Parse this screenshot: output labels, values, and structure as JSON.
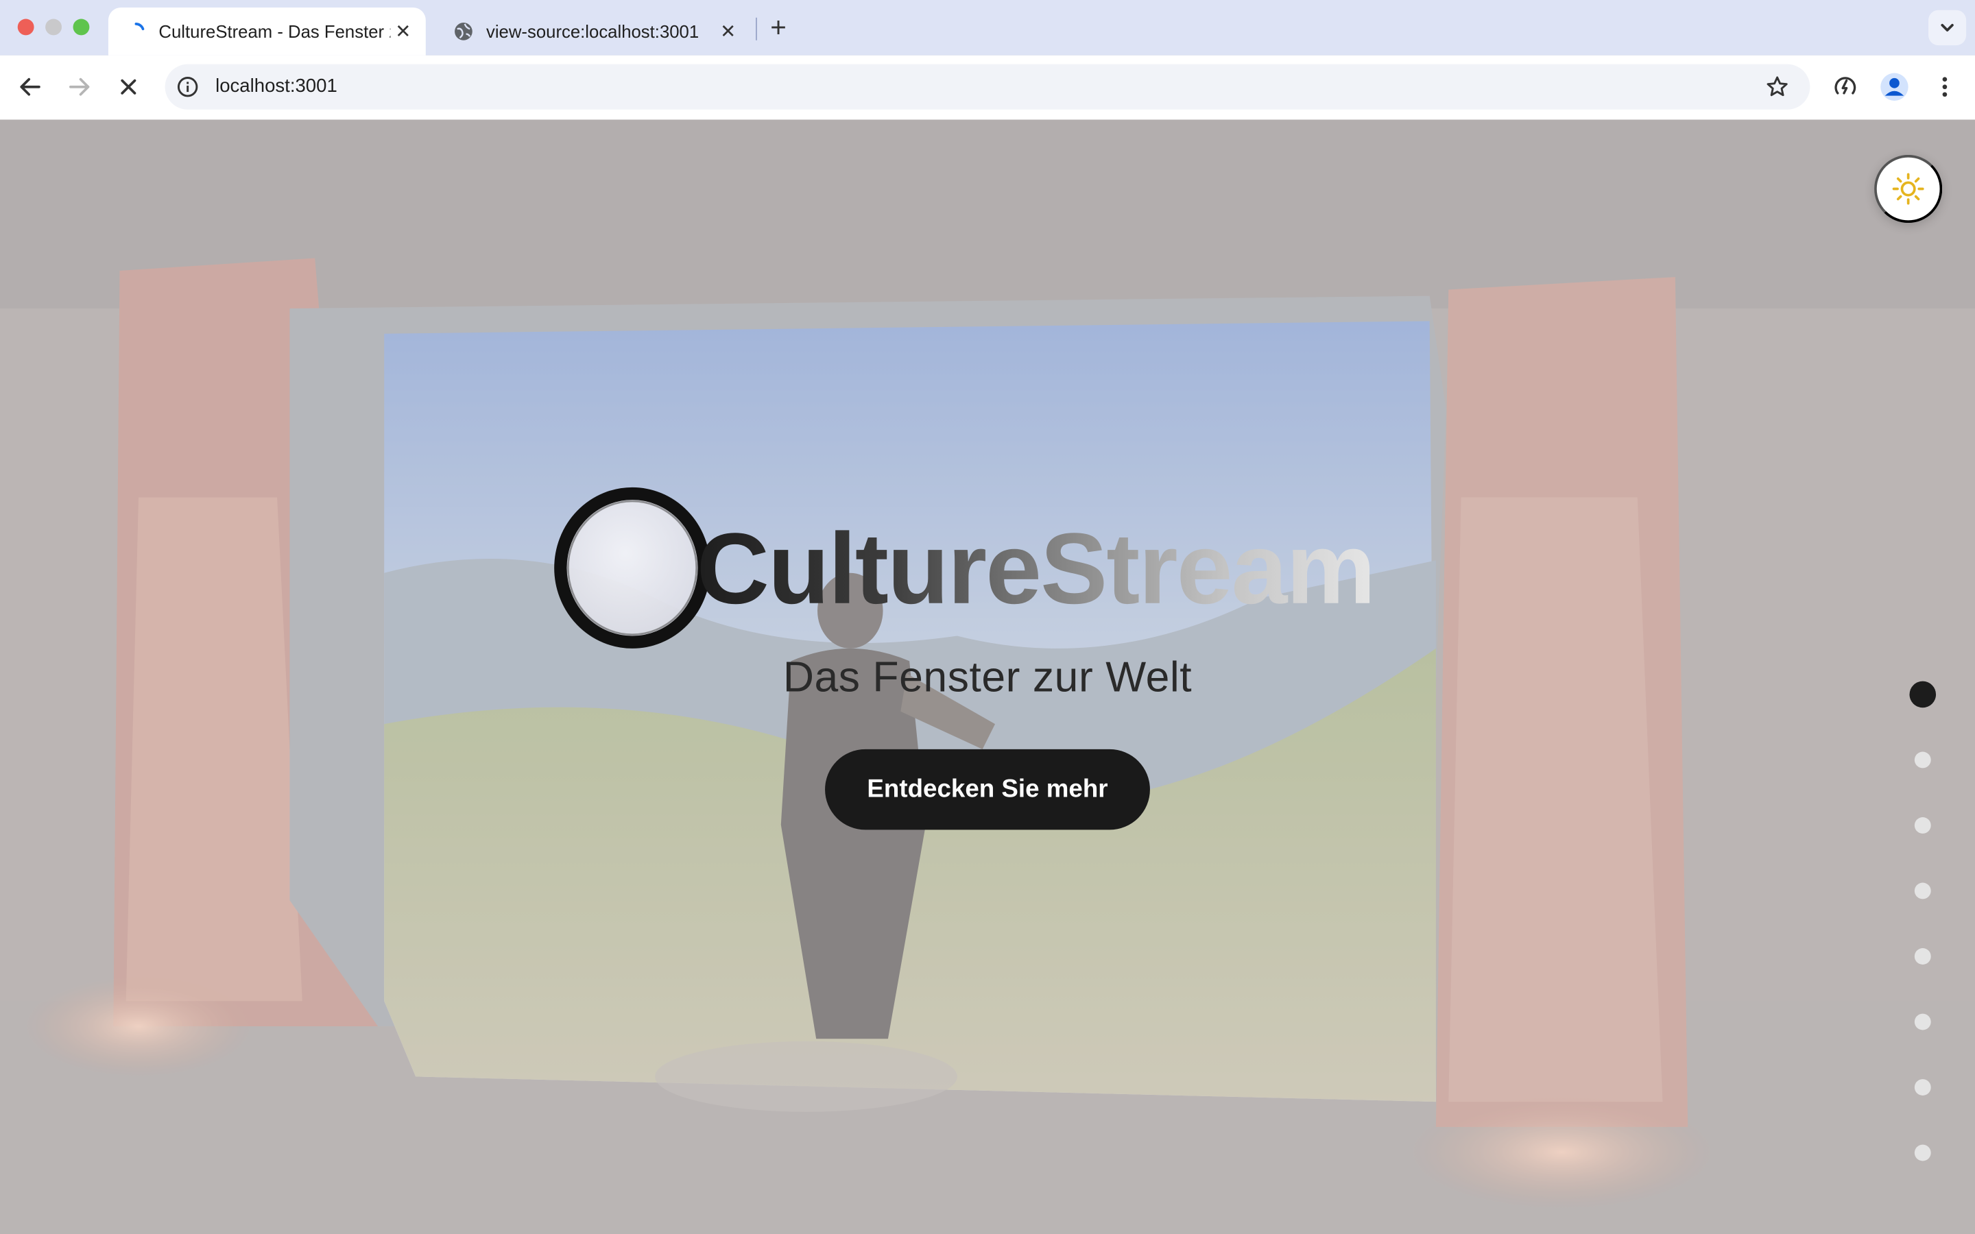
{
  "browser": {
    "tabs": [
      {
        "title": "CultureStream - Das Fenster zur Welt",
        "active": true,
        "loading": true
      },
      {
        "title": "view-source:localhost:3001",
        "active": false
      }
    ],
    "new_tab_label": "+",
    "url": "localhost:3001"
  },
  "page": {
    "brand": "CultureStream",
    "subtitle": "Das Fenster zur Welt",
    "cta_label": "Entdecken Sie mehr",
    "theme_icon": "sun-icon",
    "accent_color": "#e5b41f",
    "section_dots": {
      "count": 8,
      "active_index": 0
    }
  }
}
